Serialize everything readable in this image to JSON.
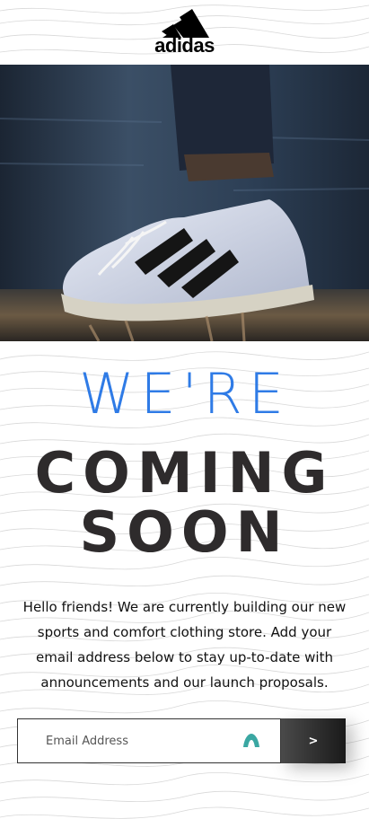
{
  "brand": {
    "name": "adidas",
    "logo_icon": "adidas-three-stripes-mountain"
  },
  "hero": {
    "image_alt": "sneaker splashing on wet ground"
  },
  "headline": {
    "line1": "WE'RE",
    "line2": "COMING",
    "line3": "SOON"
  },
  "description": "Hello friends! We are currently building our new sports and comfort clothing store. Add your email address below to stay up-to-date with announcements and our launch proposals.",
  "form": {
    "email_placeholder": "Email Address",
    "submit_label": ">",
    "field_icon": "teal-arch-icon"
  },
  "colors": {
    "accent": "#2f7be6",
    "heading": "#2e2b2c",
    "button_dark": "#1a1a1a",
    "icon_teal": "#3aa7a2"
  }
}
